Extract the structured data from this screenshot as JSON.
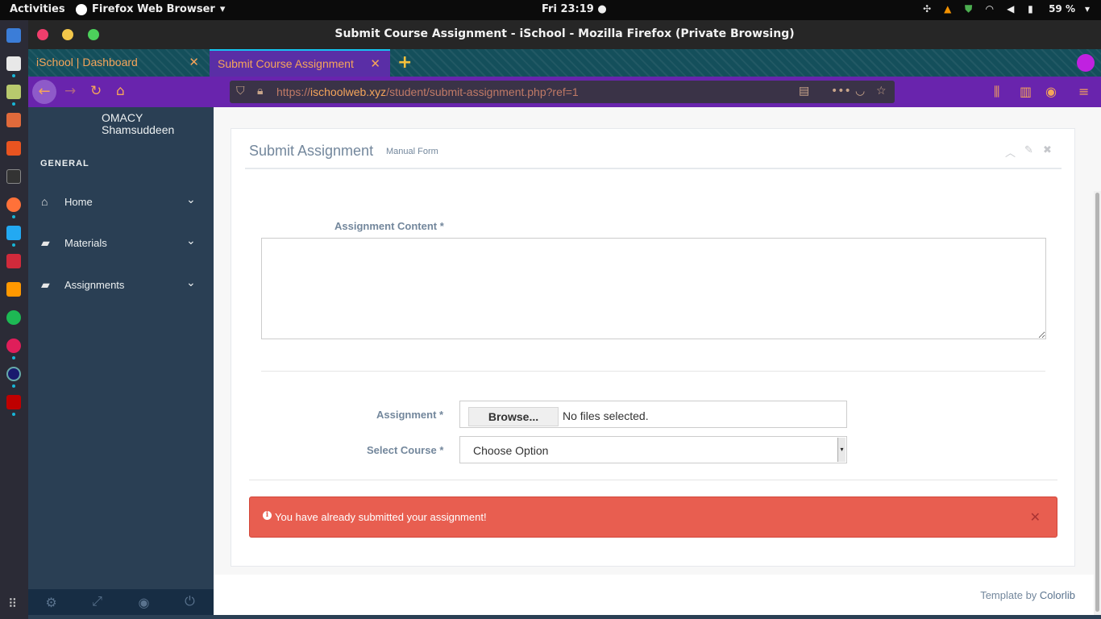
{
  "topbar": {
    "activities": "Activities",
    "app_name": "Firefox Web Browser",
    "clock": "Fri 23:19",
    "battery": "59 %"
  },
  "window": {
    "title": "Submit Course Assignment - iSchool - Mozilla Firefox (Private Browsing)"
  },
  "tabs": [
    {
      "label": "iSchool | Dashboard"
    },
    {
      "label": "Submit Course Assignment"
    }
  ],
  "url": {
    "prefix": "https://",
    "domain": "ischoolweb.xyz",
    "path": "/student/submit-assignment.php?ref=1"
  },
  "sidebar": {
    "user_line1": "OMACY",
    "user_line2": "Shamsuddeen",
    "section": "GENERAL",
    "items": [
      {
        "label": "Home",
        "icon": "home-icon"
      },
      {
        "label": "Materials",
        "icon": "book-icon"
      },
      {
        "label": "Assignments",
        "icon": "book-icon"
      }
    ]
  },
  "panel": {
    "title": "Submit Assignment",
    "subtitle": "Manual Form"
  },
  "form": {
    "content_label": "Assignment Content *",
    "content_value": "",
    "assignment_label": "Assignment *",
    "browse_label": "Browse...",
    "file_status": "No files selected.",
    "course_label": "Select Course *",
    "course_value": "Choose Option"
  },
  "alert": {
    "message": "You have already submitted your assignment!",
    "color": "#e85e50"
  },
  "footer": {
    "prefix": "Template by",
    "link": "Colorlib"
  }
}
